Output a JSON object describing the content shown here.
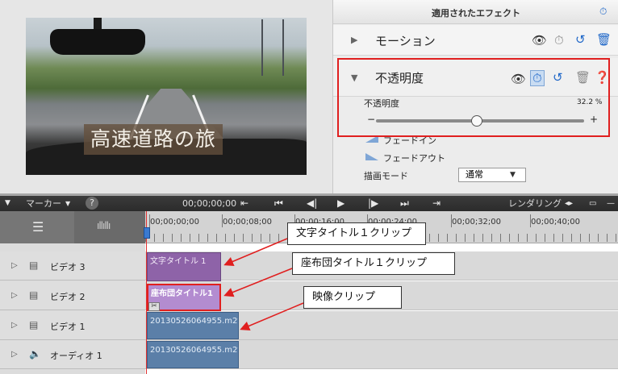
{
  "monitor": {
    "caption": "高速道路の旅"
  },
  "effects_panel": {
    "title": "適用されたエフェクト",
    "items": [
      {
        "label": "モーション",
        "expanded": false
      },
      {
        "label": "不透明度",
        "expanded": true
      }
    ],
    "opacity": {
      "param_label": "不透明度",
      "value": "32.2 %",
      "value_fraction": 0.322,
      "minus": "−",
      "plus": "+",
      "fade_in": "フェードイン",
      "fade_out": "フェードアウト"
    },
    "blend_mode": {
      "label": "描画モード",
      "value": "通常"
    }
  },
  "timeline_toolbar": {
    "marker_label": "マーカー",
    "timecode": "00;00;00;00",
    "render_label": "レンダリング"
  },
  "ruler": {
    "labels": [
      "00;00;00;00",
      "00;00;08;00",
      "00;00;16;00",
      "00;00;24;00",
      "00;00;32;00",
      "00;00;40;00"
    ]
  },
  "tracks": [
    {
      "label": "ビデオ 3",
      "type": "video"
    },
    {
      "label": "ビデオ 2",
      "type": "video"
    },
    {
      "label": "ビデオ 1",
      "type": "video"
    },
    {
      "label": "オーディオ 1",
      "type": "audio"
    }
  ],
  "clips": {
    "text_title": "文字タイトル 1",
    "cushion_title": "座布団タイトル1",
    "video": "20130526064955.m2t",
    "audio": "20130526064955.m2t"
  },
  "callouts": {
    "text_title_clip": "文字タイトル１クリップ",
    "cushion_title_clip": "座布団タイトル１クリップ",
    "video_clip": "映像クリップ"
  },
  "colors": {
    "annotation_red": "#e01f1f",
    "title_clip": "#8e63a8",
    "cushion_clip": "#b38cd0",
    "video_clip": "#5b7fa8",
    "accent_blue": "#1f67c8"
  }
}
